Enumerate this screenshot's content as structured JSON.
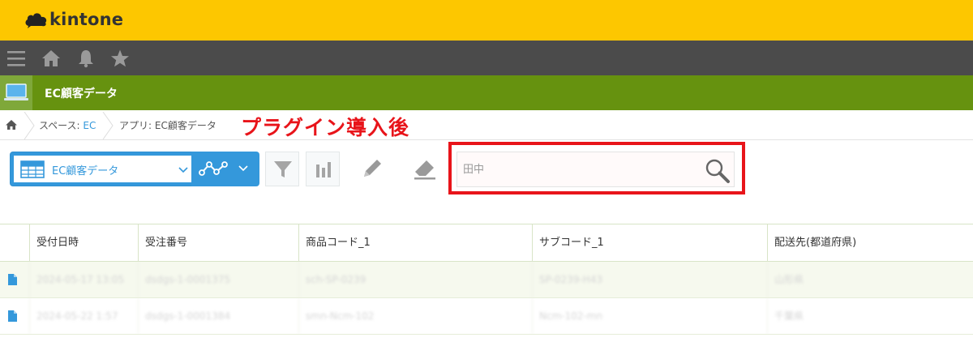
{
  "header": {
    "logo_text": "kintone",
    "brand_color": "#fdc700"
  },
  "nav": {
    "icons": [
      "menu-icon",
      "home-icon",
      "bell-icon",
      "star-icon"
    ]
  },
  "app": {
    "title": "EC顧客データ"
  },
  "breadcrumb": {
    "space_prefix": "スペース: ",
    "space_name": "EC",
    "app_label": "アプリ: EC顧客データ"
  },
  "annotation": {
    "text": "プラグイン導入後",
    "color": "#e8141a"
  },
  "toolbar": {
    "view_name": "EC顧客データ",
    "accent_color": "#3498db"
  },
  "search": {
    "value": "",
    "placeholder": "田中"
  },
  "table": {
    "columns": [
      "受付日時",
      "受注番号",
      "商品コード_1",
      "サブコード_1",
      "配送先(都道府県)"
    ],
    "rows": [
      [
        "2024-05-17 13:05",
        "dsdgs-1-0001375",
        "sch-SP-0239",
        "SP-0239-H43",
        "山形県"
      ],
      [
        "2024-05-22 1:57",
        "dsdgs-1-0001384",
        "smn-Ncm-102",
        "Ncm-102-mn",
        "千葉県"
      ]
    ]
  }
}
